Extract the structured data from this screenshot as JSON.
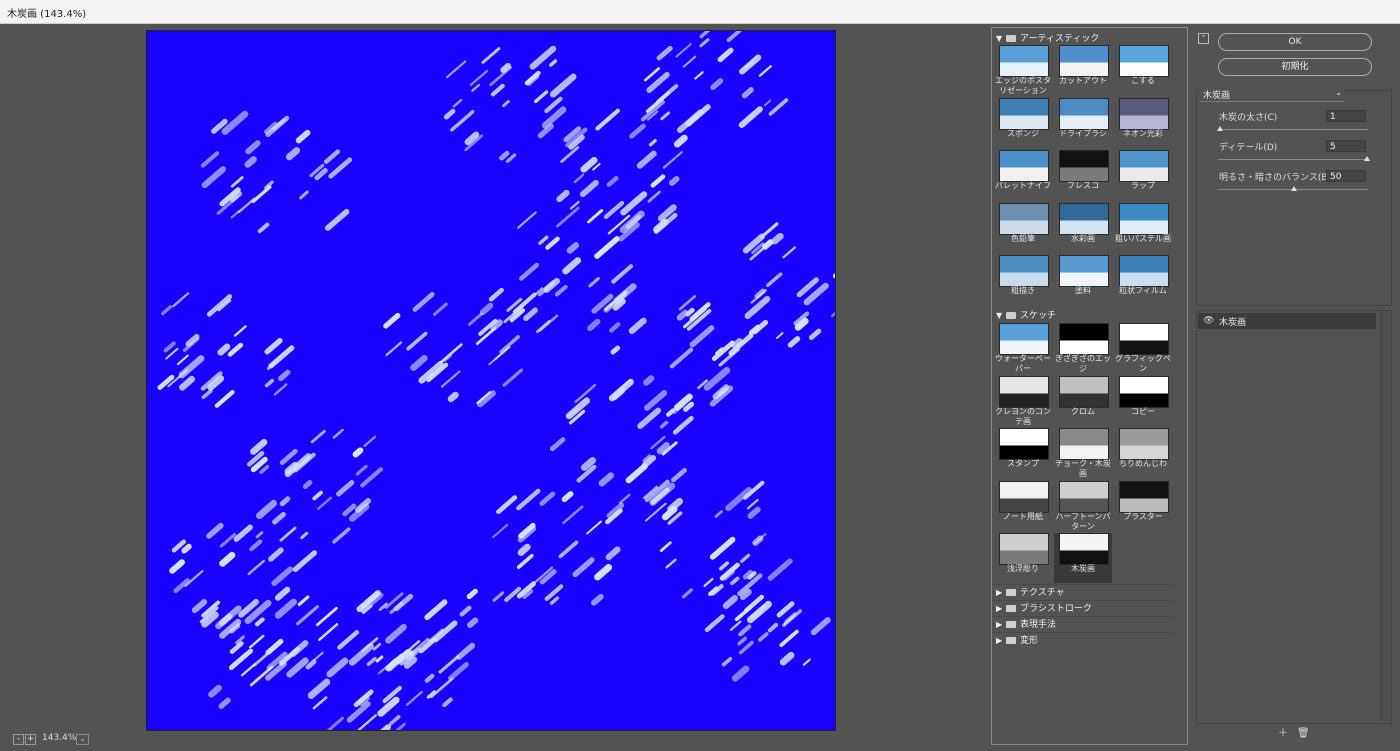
{
  "window": {
    "title": "木炭画 (143.4%)"
  },
  "status": {
    "zoom": "143.4%",
    "zoom_out": "-",
    "zoom_in": "+",
    "dropdown": "⌄"
  },
  "gallery": {
    "categories": [
      {
        "name": "アーティスティック",
        "expanded": true,
        "filters": [
          "エッジのポスタリゼーション",
          "カットアウト",
          "こする",
          "スポンジ",
          "ドライブラシ",
          "ネオン光彩",
          "パレットナイフ",
          "フレスコ",
          "ラップ",
          "色鉛筆",
          "水彩画",
          "粗いパステル画",
          "粗描き",
          "塗料",
          "粒状フィルム"
        ]
      },
      {
        "name": "スケッチ",
        "expanded": true,
        "filters": [
          "ウォーターペーパー",
          "ぎざぎざのエッジ",
          "グラフィックペン",
          "クレヨンのコンテ画",
          "クロム",
          "コピー",
          "スタンプ",
          "チョーク・木炭画",
          "ちりめんじわ",
          "ノート用紙",
          "ハーフトーンパターン",
          "プラスター",
          "浅浮彫り",
          "木炭画"
        ]
      },
      {
        "name": "テクスチャ",
        "expanded": false
      },
      {
        "name": "ブラシストローク",
        "expanded": false
      },
      {
        "name": "表現手法",
        "expanded": false
      },
      {
        "name": "変形",
        "expanded": false
      }
    ],
    "selected_filter": "木炭画"
  },
  "buttons": {
    "ok": "OK",
    "reset": "初期化",
    "collapse": "⌃"
  },
  "settings": {
    "filter": "木炭画",
    "params": [
      {
        "label": "木炭の太さ(C)",
        "value": "1",
        "fraction": 0.0
      },
      {
        "label": "ディテール(D)",
        "value": "5",
        "fraction": 1.0
      },
      {
        "label": "明るさ・暗さのバランス(B)",
        "value": "50",
        "fraction": 0.5
      }
    ]
  },
  "layers": {
    "items": [
      {
        "name": "木炭画",
        "visible": true
      }
    ],
    "new_label": "＋",
    "delete_label": "🗑"
  },
  "colors": {
    "canvas": "#1a00ff",
    "strokes": "#d9e2ff",
    "panel": "#535353"
  }
}
